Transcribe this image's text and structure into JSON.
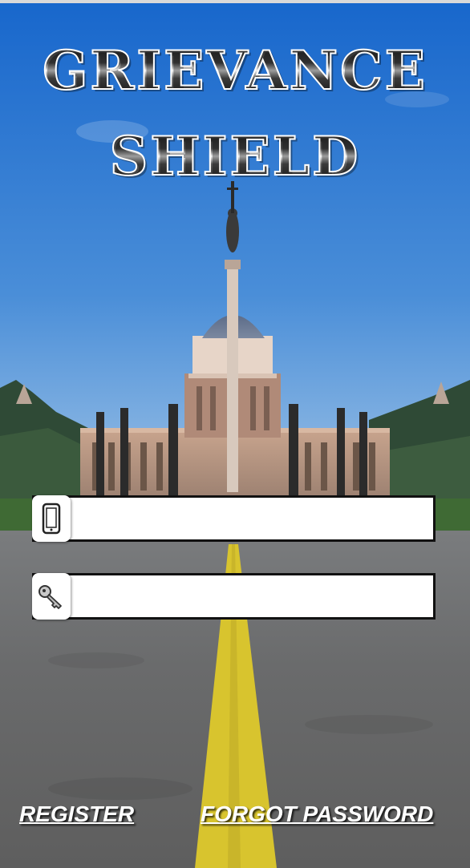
{
  "app": {
    "title_line_1": "GRIEVANCE",
    "title_line_2": "SHIELD"
  },
  "form": {
    "phone": {
      "icon": "mobile-phone-icon",
      "value": "",
      "placeholder": ""
    },
    "password": {
      "icon": "key-icon",
      "value": "",
      "placeholder": ""
    }
  },
  "links": {
    "register": "REGISTER",
    "forgot_password": "FORGOT PASSWORD"
  },
  "colors": {
    "sky_top": "#1a6fd0",
    "sky_bottom": "#9fc3e6",
    "road": "#6e6f70",
    "road_line": "#d4c02a",
    "field_border": "#111111",
    "link_text": "#ffffff"
  }
}
